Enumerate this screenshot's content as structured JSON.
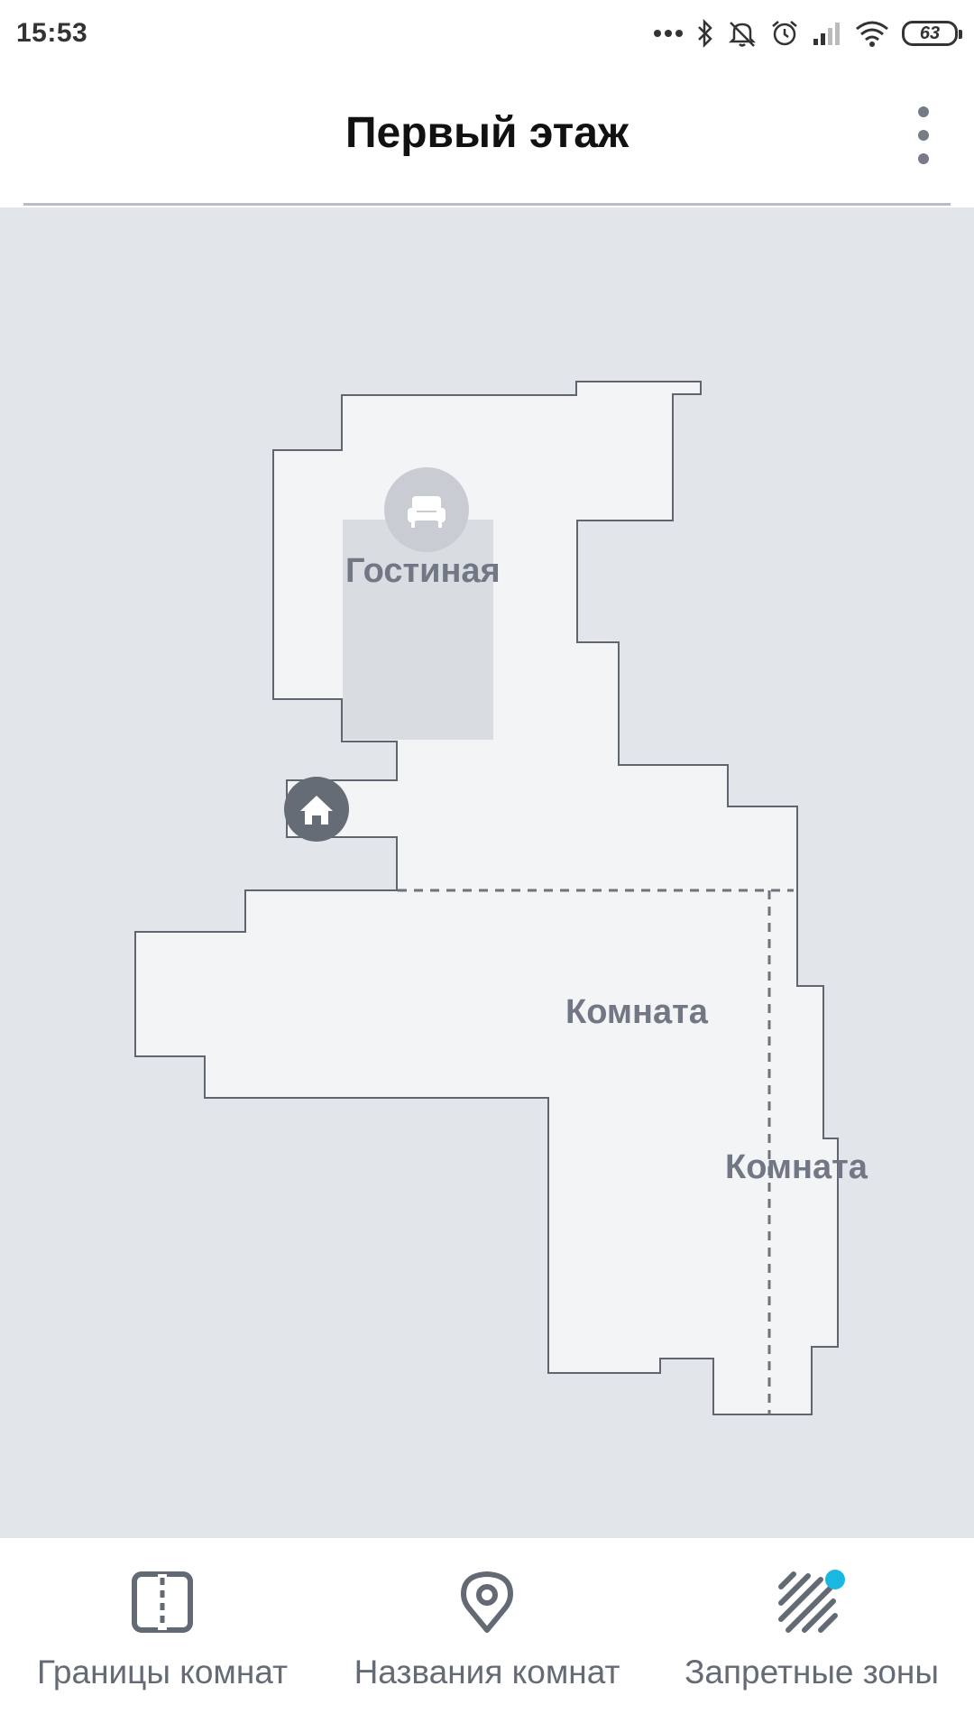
{
  "status_bar": {
    "time": "15:53",
    "battery_level": "63",
    "icons": [
      "more-dots-icon",
      "bluetooth-icon",
      "mute-icon",
      "alarm-icon",
      "cell-signal-icon",
      "wifi-icon",
      "battery-icon"
    ]
  },
  "header": {
    "title": "Первый этаж",
    "menu_icon": "more-vert-icon"
  },
  "map": {
    "rooms": [
      {
        "label": "Гостиная",
        "icon": "armchair-icon"
      },
      {
        "label": "Комната"
      },
      {
        "label": "Комната"
      }
    ],
    "dock_icon": "home-icon",
    "colors": {
      "background": "#e2e5ea",
      "floor": "#f3f4f6",
      "wall": "#5f6670",
      "label": "#717784",
      "dock": "#666c75"
    }
  },
  "toolbar": {
    "items": [
      {
        "label": "Границы комнат",
        "icon": "room-split-icon"
      },
      {
        "label": "Названия комнат",
        "icon": "location-pin-icon"
      },
      {
        "label": "Запретные зоны",
        "icon": "no-go-zone-icon",
        "badge_color": "#1ab8e0"
      }
    ]
  }
}
